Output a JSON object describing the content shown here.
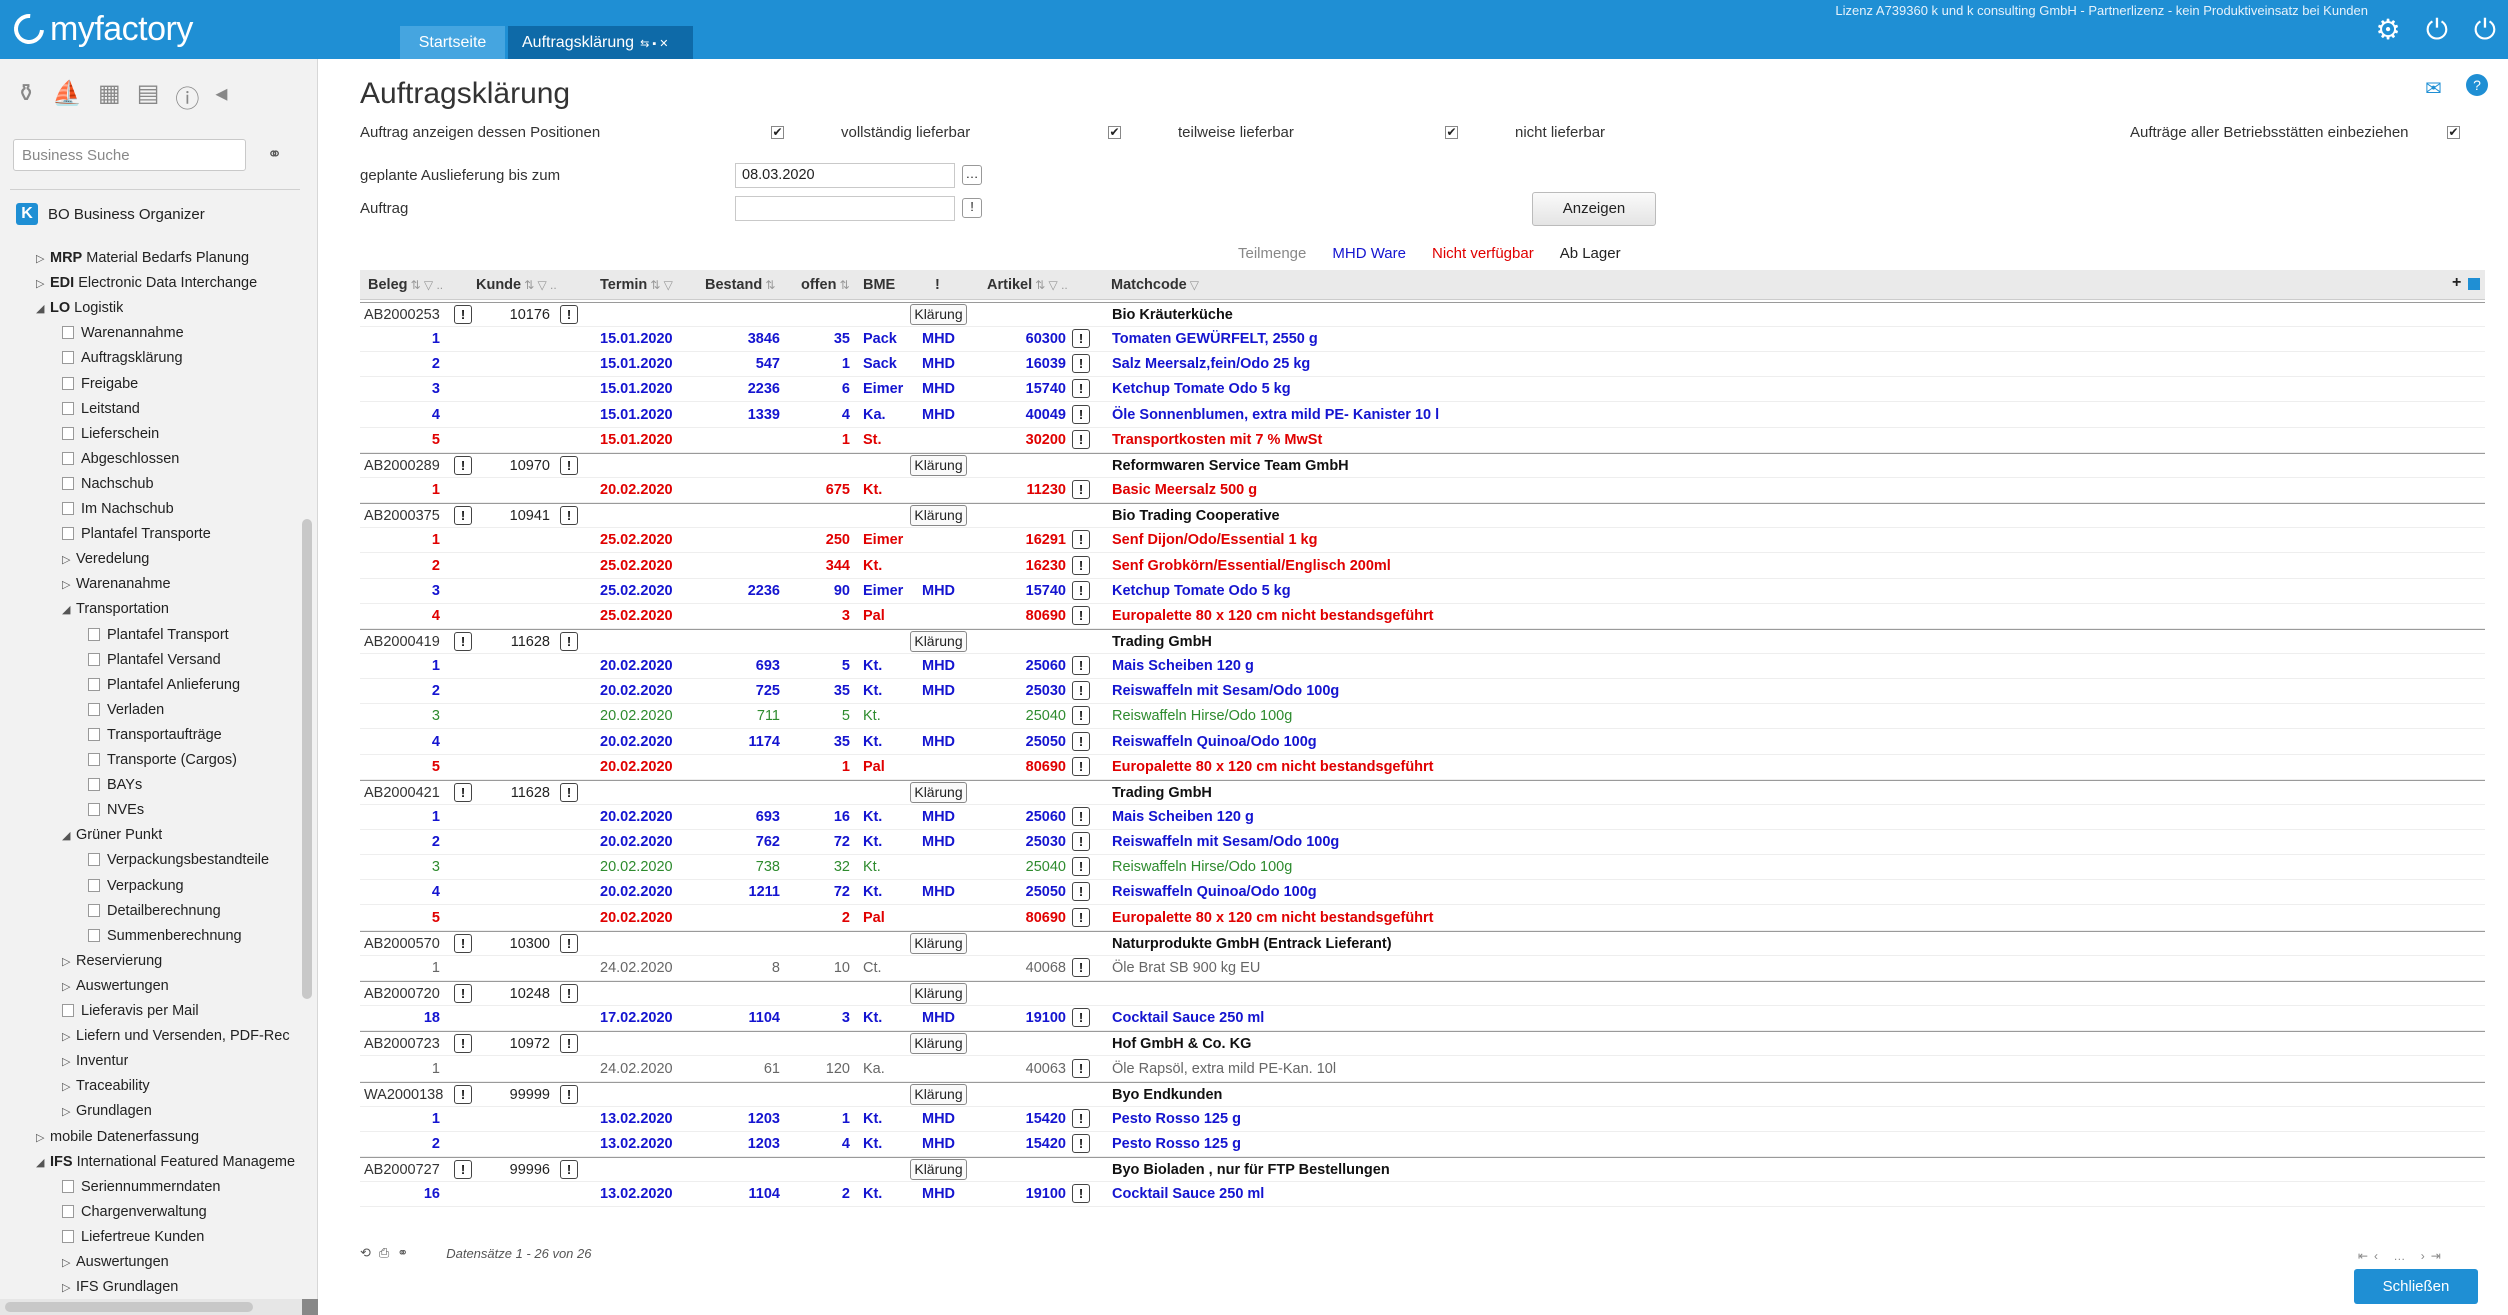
{
  "app": {
    "name": "myfactory"
  },
  "tabs": [
    {
      "label": "Startseite"
    },
    {
      "label": "Auftragsklärung"
    }
  ],
  "license_text": "Lizenz A739360 k und k consulting GmbH - Partnerlizenz - kein Produktiveinsatz bei Kunden",
  "sidebar": {
    "search_placeholder": "Business Suche",
    "bo_title": "BO Business Organizer",
    "tree": [
      {
        "level": 0,
        "label": "MRP",
        "desc": "Material Bedarfs Planung",
        "bold": true,
        "arrow": "▷"
      },
      {
        "level": 0,
        "label": "EDI",
        "desc": "Electronic Data Interchange",
        "bold": true,
        "arrow": "▷"
      },
      {
        "level": 0,
        "label": "LO",
        "desc": "Logistik",
        "bold": true,
        "arrow": "◢"
      },
      {
        "level": 1,
        "label": "Warenannahme",
        "doc": true
      },
      {
        "level": 1,
        "label": "Auftragsklärung",
        "doc": true
      },
      {
        "level": 1,
        "label": "Freigabe",
        "doc": true
      },
      {
        "level": 1,
        "label": "Leitstand",
        "doc": true
      },
      {
        "level": 1,
        "label": "Lieferschein",
        "doc": true
      },
      {
        "level": 1,
        "label": "Abgeschlossen",
        "doc": true
      },
      {
        "level": 1,
        "label": "Nachschub",
        "doc": true
      },
      {
        "level": 1,
        "label": "Im Nachschub",
        "doc": true
      },
      {
        "level": 1,
        "label": "Plantafel Transporte",
        "doc": true
      },
      {
        "level": 1,
        "label": "Veredelung",
        "arrow": "▷"
      },
      {
        "level": 1,
        "label": "Warenanahme",
        "arrow": "▷"
      },
      {
        "level": 1,
        "label": "Transportation",
        "arrow": "◢"
      },
      {
        "level": 2,
        "label": "Plantafel Transport",
        "doc": true
      },
      {
        "level": 2,
        "label": "Plantafel Versand",
        "doc": true
      },
      {
        "level": 2,
        "label": "Plantafel Anlieferung",
        "doc": true
      },
      {
        "level": 2,
        "label": "Verladen",
        "doc": true
      },
      {
        "level": 2,
        "label": "Transportaufträge",
        "doc": true
      },
      {
        "level": 2,
        "label": "Transporte (Cargos)",
        "doc": true
      },
      {
        "level": 2,
        "label": "BAYs",
        "doc": true
      },
      {
        "level": 2,
        "label": "NVEs",
        "doc": true
      },
      {
        "level": 1,
        "label": "Grüner Punkt",
        "arrow": "◢"
      },
      {
        "level": 2,
        "label": "Verpackungsbestandteile",
        "doc": true
      },
      {
        "level": 2,
        "label": "Verpackung",
        "doc": true
      },
      {
        "level": 2,
        "label": "Detailberechnung",
        "doc": true
      },
      {
        "level": 2,
        "label": "Summenberechnung",
        "doc": true
      },
      {
        "level": 1,
        "label": "Reservierung",
        "arrow": "▷"
      },
      {
        "level": 1,
        "label": "Auswertungen",
        "arrow": "▷"
      },
      {
        "level": 1,
        "label": "Lieferavis per Mail",
        "doc": true
      },
      {
        "level": 1,
        "label": "Liefern und Versenden, PDF-Rec",
        "arrow": "▷"
      },
      {
        "level": 1,
        "label": "Inventur",
        "arrow": "▷"
      },
      {
        "level": 1,
        "label": "Traceability",
        "arrow": "▷"
      },
      {
        "level": 1,
        "label": "Grundlagen",
        "arrow": "▷"
      },
      {
        "level": 0,
        "label": "mobile Datenerfassung",
        "arrow": "▷"
      },
      {
        "level": 0,
        "label": "IFS",
        "desc": "International Featured Manageme",
        "bold": true,
        "arrow": "◢"
      },
      {
        "level": 1,
        "label": "Seriennummerndaten",
        "doc": true
      },
      {
        "level": 1,
        "label": "Chargenverwaltung",
        "doc": true
      },
      {
        "level": 1,
        "label": "Liefertreue Kunden",
        "doc": true
      },
      {
        "level": 1,
        "label": "Auswertungen",
        "arrow": "▷"
      },
      {
        "level": 1,
        "label": "IFS Grundlagen",
        "arrow": "▷"
      }
    ]
  },
  "main": {
    "title": "Auftragsklärung",
    "filters": {
      "show_orders_label": "Auftrag anzeigen dessen Positionen",
      "fully_label": "vollständig lieferbar",
      "partial_label": "teilweise lieferbar",
      "not_label": "nicht lieferbar",
      "all_sites_label": "Aufträge aller Betriebsstätten einbeziehen",
      "planned_delivery_label": "geplante Auslieferung bis zum",
      "planned_delivery_value": "08.03.2020",
      "order_label": "Auftrag",
      "order_value": "",
      "show_button": "Anzeigen"
    },
    "legend": [
      {
        "label": "Teilmenge",
        "color": "#888888"
      },
      {
        "label": "MHD Ware",
        "color": "#1414d0"
      },
      {
        "label": "Nicht verfügbar",
        "color": "#e00000"
      },
      {
        "label": "Ab Lager",
        "color": "#222222"
      }
    ],
    "columns": {
      "beleg": "Beleg",
      "kunde": "Kunde",
      "termin": "Termin",
      "bestand": "Bestand",
      "offen": "offen",
      "bme": "BME",
      "ausruf": "!",
      "artikel": "Artikel",
      "matchcode": "Matchcode",
      "dots": ".."
    },
    "klaerung_label": "Klärung",
    "rows": [
      {
        "type": "head",
        "beleg": "AB2000253",
        "kunde": "10176",
        "match": "Bio Kräuterküche"
      },
      {
        "type": "pos",
        "color": "blue",
        "pos": "1",
        "termin": "15.01.2020",
        "bestand": "3846",
        "offen": "35",
        "bme": "Pack",
        "mhd": "MHD",
        "artikel": "60300",
        "match": "Tomaten GEWÜRFELT, 2550 g"
      },
      {
        "type": "pos",
        "color": "blue",
        "pos": "2",
        "termin": "15.01.2020",
        "bestand": "547",
        "offen": "1",
        "bme": "Sack",
        "mhd": "MHD",
        "artikel": "16039",
        "match": "Salz Meersalz,fein/Odo 25 kg"
      },
      {
        "type": "pos",
        "color": "blue",
        "pos": "3",
        "termin": "15.01.2020",
        "bestand": "2236",
        "offen": "6",
        "bme": "Eimer",
        "mhd": "MHD",
        "artikel": "15740",
        "match": "Ketchup Tomate Odo 5 kg"
      },
      {
        "type": "pos",
        "color": "blue",
        "pos": "4",
        "termin": "15.01.2020",
        "bestand": "1339",
        "offen": "4",
        "bme": "Ka.",
        "mhd": "MHD",
        "artikel": "40049",
        "match": "Öle Sonnenblumen, extra mild PE- Kanister 10 l"
      },
      {
        "type": "pos",
        "color": "red",
        "pos": "5",
        "termin": "15.01.2020",
        "bestand": "",
        "offen": "1",
        "bme": "St.",
        "mhd": "",
        "artikel": "30200",
        "match": "Transportkosten mit 7 % MwSt"
      },
      {
        "type": "head",
        "beleg": "AB2000289",
        "kunde": "10970",
        "match": "Reformwaren Service Team GmbH"
      },
      {
        "type": "pos",
        "color": "red",
        "pos": "1",
        "termin": "20.02.2020",
        "bestand": "",
        "offen": "675",
        "bme": "Kt.",
        "mhd": "",
        "artikel": "11230",
        "match": "Basic Meersalz 500 g"
      },
      {
        "type": "head",
        "beleg": "AB2000375",
        "kunde": "10941",
        "match": "Bio Trading Cooperative"
      },
      {
        "type": "pos",
        "color": "red",
        "pos": "1",
        "termin": "25.02.2020",
        "bestand": "",
        "offen": "250",
        "bme": "Eimer",
        "mhd": "",
        "artikel": "16291",
        "match": "Senf Dijon/Odo/Essential 1 kg"
      },
      {
        "type": "pos",
        "color": "red",
        "pos": "2",
        "termin": "25.02.2020",
        "bestand": "",
        "offen": "344",
        "bme": "Kt.",
        "mhd": "",
        "artikel": "16230",
        "match": "Senf Grobkörn/Essential/Englisch 200ml"
      },
      {
        "type": "pos",
        "color": "blue",
        "pos": "3",
        "termin": "25.02.2020",
        "bestand": "2236",
        "offen": "90",
        "bme": "Eimer",
        "mhd": "MHD",
        "artikel": "15740",
        "match": "Ketchup Tomate Odo 5 kg"
      },
      {
        "type": "pos",
        "color": "red",
        "pos": "4",
        "termin": "25.02.2020",
        "bestand": "",
        "offen": "3",
        "bme": "Pal",
        "mhd": "",
        "artikel": "80690",
        "match": "Europalette 80 x 120 cm nicht bestandsgeführt"
      },
      {
        "type": "head",
        "beleg": "AB2000419",
        "kunde": "11628",
        "match": "Trading GmbH"
      },
      {
        "type": "pos",
        "color": "blue",
        "pos": "1",
        "termin": "20.02.2020",
        "bestand": "693",
        "offen": "5",
        "bme": "Kt.",
        "mhd": "MHD",
        "artikel": "25060",
        "match": "Mais Scheiben 120 g"
      },
      {
        "type": "pos",
        "color": "blue",
        "pos": "2",
        "termin": "20.02.2020",
        "bestand": "725",
        "offen": "35",
        "bme": "Kt.",
        "mhd": "MHD",
        "artikel": "25030",
        "match": "Reiswaffeln mit Sesam/Odo 100g"
      },
      {
        "type": "pos",
        "color": "green",
        "pos": "3",
        "termin": "20.02.2020",
        "bestand": "711",
        "offen": "5",
        "bme": "Kt.",
        "mhd": "",
        "artikel": "25040",
        "match": "Reiswaffeln Hirse/Odo 100g"
      },
      {
        "type": "pos",
        "color": "blue",
        "pos": "4",
        "termin": "20.02.2020",
        "bestand": "1174",
        "offen": "35",
        "bme": "Kt.",
        "mhd": "MHD",
        "artikel": "25050",
        "match": "Reiswaffeln Quinoa/Odo 100g"
      },
      {
        "type": "pos",
        "color": "red",
        "pos": "5",
        "termin": "20.02.2020",
        "bestand": "",
        "offen": "1",
        "bme": "Pal",
        "mhd": "",
        "artikel": "80690",
        "match": "Europalette 80 x 120 cm nicht bestandsgeführt"
      },
      {
        "type": "head",
        "beleg": "AB2000421",
        "kunde": "11628",
        "match": "Trading GmbH"
      },
      {
        "type": "pos",
        "color": "blue",
        "pos": "1",
        "termin": "20.02.2020",
        "bestand": "693",
        "offen": "16",
        "bme": "Kt.",
        "mhd": "MHD",
        "artikel": "25060",
        "match": "Mais Scheiben 120 g"
      },
      {
        "type": "pos",
        "color": "blue",
        "pos": "2",
        "termin": "20.02.2020",
        "bestand": "762",
        "offen": "72",
        "bme": "Kt.",
        "mhd": "MHD",
        "artikel": "25030",
        "match": "Reiswaffeln mit Sesam/Odo 100g"
      },
      {
        "type": "pos",
        "color": "green",
        "pos": "3",
        "termin": "20.02.2020",
        "bestand": "738",
        "offen": "32",
        "bme": "Kt.",
        "mhd": "",
        "artikel": "25040",
        "match": "Reiswaffeln Hirse/Odo 100g"
      },
      {
        "type": "pos",
        "color": "blue",
        "pos": "4",
        "termin": "20.02.2020",
        "bestand": "1211",
        "offen": "72",
        "bme": "Kt.",
        "mhd": "MHD",
        "artikel": "25050",
        "match": "Reiswaffeln Quinoa/Odo 100g"
      },
      {
        "type": "pos",
        "color": "red",
        "pos": "5",
        "termin": "20.02.2020",
        "bestand": "",
        "offen": "2",
        "bme": "Pal",
        "mhd": "",
        "artikel": "80690",
        "match": "Europalette 80 x 120 cm nicht bestandsgeführt"
      },
      {
        "type": "head",
        "beleg": "AB2000570",
        "kunde": "10300",
        "match": "Naturprodukte GmbH (Entrack Lieferant)"
      },
      {
        "type": "pos",
        "color": "gray",
        "pos": "1",
        "termin": "24.02.2020",
        "bestand": "8",
        "offen": "10",
        "bme": "Ct.",
        "mhd": "",
        "artikel": "40068",
        "match": "Öle Brat SB 900 kg EU"
      },
      {
        "type": "head",
        "beleg": "AB2000720",
        "kunde": "10248",
        "match": ""
      },
      {
        "type": "pos",
        "color": "blue",
        "pos": "18",
        "termin": "17.02.2020",
        "bestand": "1104",
        "offen": "3",
        "bme": "Kt.",
        "mhd": "MHD",
        "artikel": "19100",
        "match": "Cocktail Sauce 250 ml"
      },
      {
        "type": "head",
        "beleg": "AB2000723",
        "kunde": "10972",
        "match": "Hof GmbH & Co. KG"
      },
      {
        "type": "pos",
        "color": "gray",
        "pos": "1",
        "termin": "24.02.2020",
        "bestand": "61",
        "offen": "120",
        "bme": "Ka.",
        "mhd": "",
        "artikel": "40063",
        "match": "Öle Rapsöl, extra mild PE-Kan. 10l"
      },
      {
        "type": "head",
        "beleg": "WA2000138",
        "kunde": "99999",
        "match": "Byo Endkunden"
      },
      {
        "type": "pos",
        "color": "blue",
        "pos": "1",
        "termin": "13.02.2020",
        "bestand": "1203",
        "offen": "1",
        "bme": "Kt.",
        "mhd": "MHD",
        "artikel": "15420",
        "match": "Pesto Rosso 125 g"
      },
      {
        "type": "pos",
        "color": "blue",
        "pos": "2",
        "termin": "13.02.2020",
        "bestand": "1203",
        "offen": "4",
        "bme": "Kt.",
        "mhd": "MHD",
        "artikel": "15420",
        "match": "Pesto Rosso 125 g"
      },
      {
        "type": "head",
        "beleg": "AB2000727",
        "kunde": "99996",
        "match": "Byo Bioladen , nur für FTP Bestellungen"
      },
      {
        "type": "pos",
        "color": "blue",
        "pos": "16",
        "termin": "13.02.2020",
        "bestand": "1104",
        "offen": "2",
        "bme": "Kt.",
        "mhd": "MHD",
        "artikel": "19100",
        "match": "Cocktail Sauce 250 ml"
      }
    ],
    "footer_text": "Datensätze 1 - 26 von 26",
    "close_button": "Schließen"
  }
}
